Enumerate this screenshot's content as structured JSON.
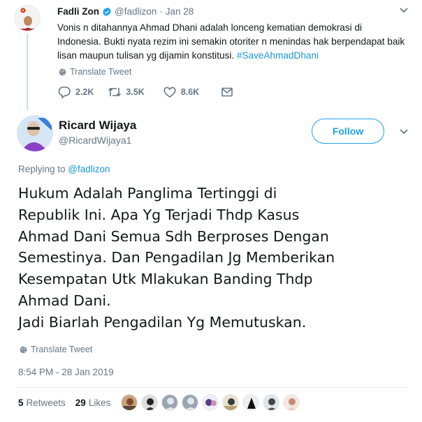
{
  "parent_tweet": {
    "display_name": "Fadli Zon",
    "handle": "@fadlizon",
    "separator": "·",
    "date": "Jan 28",
    "text_plain": "Vonis n ditahannya Ahmad Dhani adalah lonceng kematian demokrasi di Indonesia. Bukti nyata rezim ini semakin otoriter n menindas hak berpendapat baik lisan maupun tulisan yg dijamin konstitusi. ",
    "hashtag": "#SaveAhmadDhani",
    "translate_label": "Translate Tweet",
    "reply_count": "2.2K",
    "retweet_count": "3.5K",
    "like_count": "8.6K"
  },
  "main_tweet": {
    "display_name": "Ricard Wijaya",
    "handle": "@RicardWijaya1",
    "follow_label": "Follow",
    "replying_prefix": "Replying to ",
    "replying_handle": "@fadlizon",
    "text_lines": [
      "Hukum Adalah Panglima Tertinggi di",
      "Republik Ini. Apa Yg Terjadi Thdp Kasus",
      "Ahmad Dani Semua Sdh Berproses Dengan",
      "Semestinya. Dan Pengadilan Jg Memberikan",
      "Kesempatan Utk Mlakukan Banding Thdp",
      "Ahmad Dani.",
      "Jadi Biarlah Pengadilan Yg Memutuskan."
    ],
    "translate_label": "Translate Tweet",
    "timestamp": "8:54 PM - 28 Jan 2019",
    "retweets_count": "5",
    "retweets_label": "Retweets",
    "likes_count": "29",
    "likes_label": "Likes"
  },
  "colors": {
    "accent": "#1da1f2",
    "link": "#1b95e0",
    "muted": "#657786",
    "text": "#14171a",
    "thread_line": "#c8e0ef"
  },
  "icons": [
    "verified-badge-icon",
    "chevron-down-icon",
    "globe-icon",
    "reply-icon",
    "retweet-icon",
    "like-icon",
    "direct-message-icon"
  ]
}
